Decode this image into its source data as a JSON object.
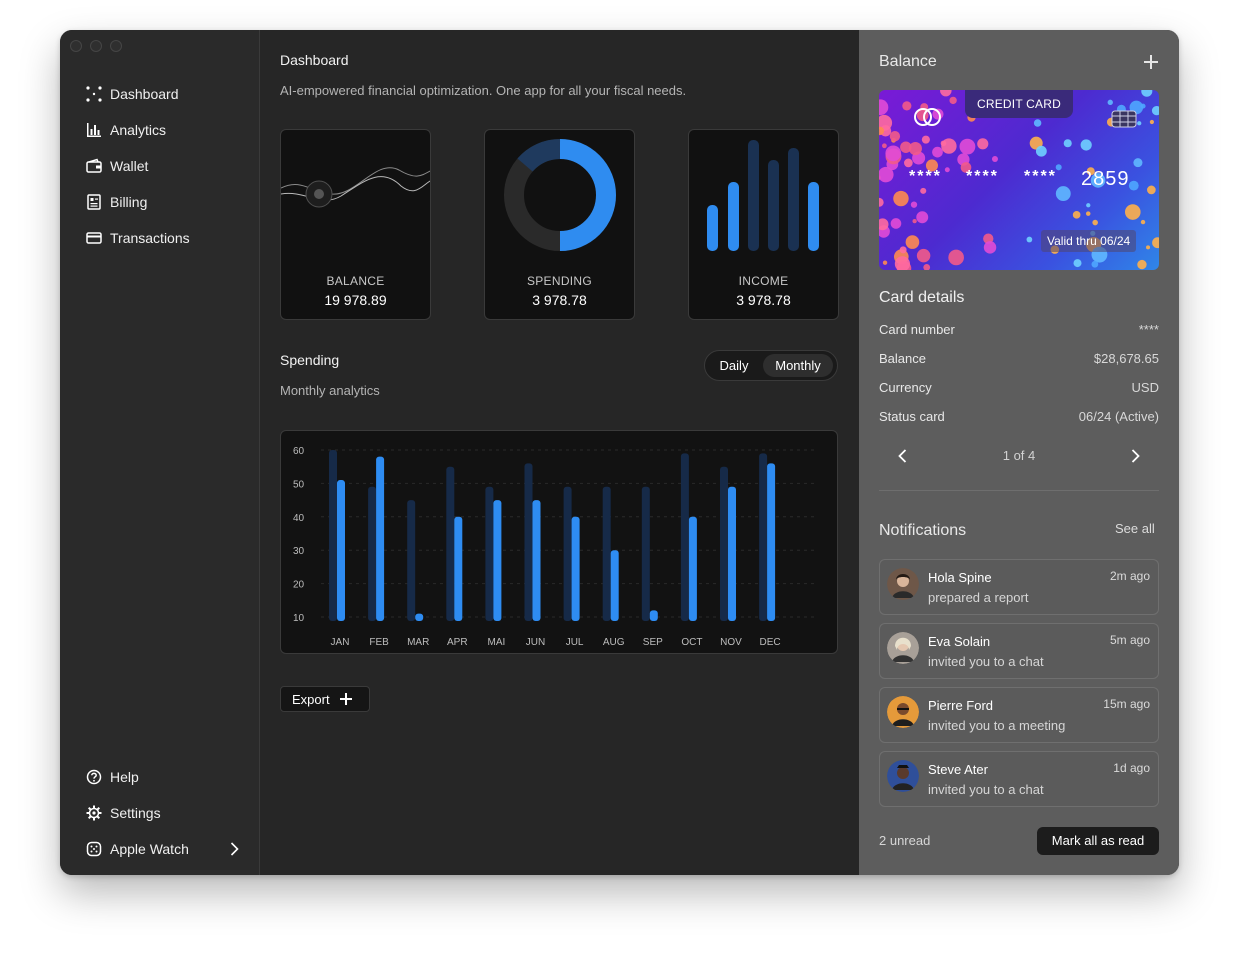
{
  "sidebar": {
    "items": [
      {
        "label": "Dashboard",
        "icon": "grid-dots-icon"
      },
      {
        "label": "Analytics",
        "icon": "bar-chart-icon"
      },
      {
        "label": "Wallet",
        "icon": "wallet-icon"
      },
      {
        "label": "Billing",
        "icon": "receipt-icon"
      },
      {
        "label": "Transactions",
        "icon": "credit-card-icon"
      }
    ],
    "bottom": [
      {
        "label": "Help",
        "icon": "help-icon"
      },
      {
        "label": "Settings",
        "icon": "gear-icon"
      },
      {
        "label": "Apple Watch",
        "icon": "watch-icon"
      }
    ]
  },
  "main": {
    "title": "Dashboard",
    "subtitle": "AI-empowered financial optimization. One app for all your fiscal needs.",
    "stats": [
      {
        "label": "BALANCE",
        "value": "19 978.89"
      },
      {
        "label": "SPENDING",
        "value": "3 978.78"
      },
      {
        "label": "INCOME",
        "value": "3 978.78"
      }
    ],
    "spending": {
      "title": "Spending",
      "subtitle": "Monthly analytics",
      "toggle": {
        "daily": "Daily",
        "monthly": "Monthly",
        "selected": "Monthly"
      }
    },
    "export_label": "Export"
  },
  "chart_data": {
    "type": "bar",
    "categories": [
      "JAN",
      "FEB",
      "MAR",
      "APR",
      "MAI",
      "JUN",
      "JUL",
      "AUG",
      "SEP",
      "OCT",
      "NOV",
      "DEC"
    ],
    "series": [
      {
        "values": [
          60,
          49,
          45,
          55,
          49,
          56,
          49,
          49,
          49,
          59,
          55,
          59
        ]
      },
      {
        "values": [
          51,
          58,
          11,
          40,
          45,
          45,
          40,
          30,
          12,
          40,
          49,
          56
        ]
      }
    ],
    "yticks": [
      10,
      20,
      30,
      40,
      50,
      60
    ],
    "ylim": [
      10,
      60
    ],
    "colors": [
      "#162a48",
      "#2e8cf2"
    ]
  },
  "right": {
    "title": "Balance",
    "card": {
      "type_label": "CREDIT CARD",
      "num1": "****",
      "num2": "****",
      "num3": "****",
      "last4": "2859",
      "valid": "Valid thru 06/24"
    },
    "details_title": "Card details",
    "details": [
      {
        "key": "Card number",
        "value": "****"
      },
      {
        "key": "Balance",
        "value": "$28,678.65"
      },
      {
        "key": "Currency",
        "value": "USD"
      },
      {
        "key": "Status card",
        "value": "06/24 (Active)"
      }
    ],
    "pager": "1 of 4",
    "notifications_title": "Notifications",
    "see_all": "See all",
    "notifications": [
      {
        "name": "Hola Spine",
        "message": "prepared a report",
        "time": "2m ago",
        "avatar_color": "#8a6a5a"
      },
      {
        "name": "Eva Solain",
        "message": "invited you to a chat",
        "time": "5m ago",
        "avatar_color": "#b8b0a8"
      },
      {
        "name": "Pierre Ford",
        "message": "invited you to a meeting",
        "time": "15m ago",
        "avatar_color": "#e59a3a"
      },
      {
        "name": "Steve Ater",
        "message": "invited you to a chat",
        "time": "1d ago",
        "avatar_color": "#3a5fb8"
      }
    ],
    "unread": "2 unread",
    "mark_all": "Mark all as read"
  }
}
